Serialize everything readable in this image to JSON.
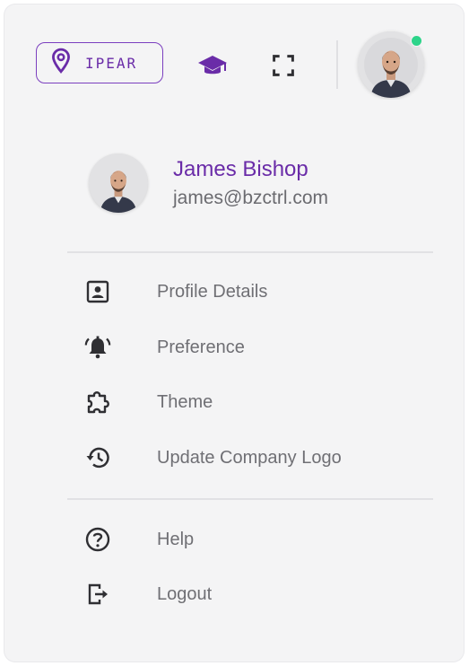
{
  "topbar": {
    "location_label": "IPEAR",
    "location_icon": "map-pin-icon",
    "graduation_icon": "graduation-cap-icon",
    "fullscreen_icon": "fullscreen-icon",
    "online_status_color": "#2dd48a"
  },
  "profile": {
    "name": "James Bishop",
    "email": "james@bzctrl.com"
  },
  "menu": {
    "primary": [
      {
        "label": "Profile Details",
        "icon": "profile-card-icon"
      },
      {
        "label": "Preference",
        "icon": "bell-ringing-icon"
      },
      {
        "label": "Theme",
        "icon": "puzzle-icon"
      },
      {
        "label": "Update Company Logo",
        "icon": "history-icon"
      }
    ],
    "secondary": [
      {
        "label": "Help",
        "icon": "help-circle-icon"
      },
      {
        "label": "Logout",
        "icon": "logout-icon"
      }
    ]
  },
  "colors": {
    "accent": "#6a2ca8",
    "text_muted": "#6f6f74",
    "icon_dark": "#2f2f33"
  }
}
